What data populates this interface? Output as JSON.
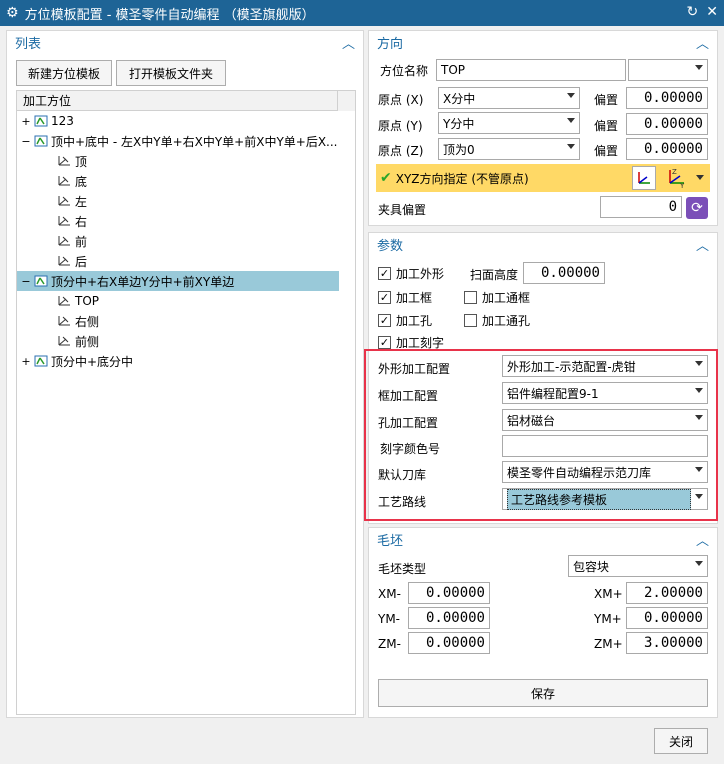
{
  "window": {
    "title": "方位模板配置 - 模圣零件自动编程 （模圣旗舰版）"
  },
  "list": {
    "header": "列表",
    "new_button": "新建方位模板",
    "open_folder_button": "打开模板文件夹",
    "tree_header": "加工方位",
    "items": [
      {
        "label": "123",
        "level": 0,
        "exp": "+"
      },
      {
        "label": "顶中+底中 - 左X中Y单+右X中Y单+前X中Y单+后X...",
        "level": 0,
        "exp": "−"
      },
      {
        "label": "顶",
        "level": 1
      },
      {
        "label": "底",
        "level": 1
      },
      {
        "label": "左",
        "level": 1
      },
      {
        "label": "右",
        "level": 1
      },
      {
        "label": "前",
        "level": 1
      },
      {
        "label": "后",
        "level": 1
      },
      {
        "label": "顶分中+右X单边Y分中+前XY单边",
        "level": 0,
        "exp": "−",
        "selected": true
      },
      {
        "label": "TOP",
        "level": 1
      },
      {
        "label": "右侧",
        "level": 1
      },
      {
        "label": "前侧",
        "level": 1
      },
      {
        "label": "顶分中+底分中",
        "level": 0,
        "exp": "+"
      }
    ]
  },
  "direction": {
    "header": "方向",
    "name_label": "方位名称",
    "name_value": "TOP",
    "origin_x_label": "原点 (X)",
    "origin_x_value": "X分中",
    "origin_y_label": "原点 (Y)",
    "origin_y_value": "Y分中",
    "origin_z_label": "原点 (Z)",
    "origin_z_value": "顶为0",
    "offset_label": "偏置",
    "offset_x": "0.00000",
    "offset_y": "0.00000",
    "offset_z": "0.00000",
    "xyz_label": "XYZ方向指定 (不管原点)",
    "fixture_label": "夹具偏置",
    "fixture_value": "0"
  },
  "params": {
    "header": "参数",
    "cb_outline": "加工外形",
    "scan_height_label": "扫面高度",
    "scan_height_value": "0.00000",
    "cb_frame": "加工框",
    "cb_through_frame": "加工通框",
    "cb_hole": "加工孔",
    "cb_through_hole": "加工通孔",
    "cb_engrave": "加工刻字",
    "outline_cfg_label": "外形加工配置",
    "outline_cfg_value": "外形加工-示范配置-虎钳",
    "frame_cfg_label": "框加工配置",
    "frame_cfg_value": "铝件编程配置9-1",
    "hole_cfg_label": "孔加工配置",
    "hole_cfg_value": "铝材磁台",
    "engrave_color_label": "刻字颜色号",
    "engrave_color_value": "",
    "tool_lib_label": "默认刀库",
    "tool_lib_value": "模圣零件自动编程示范刀库",
    "route_label": "工艺路线",
    "route_value": "工艺路线参考模板"
  },
  "blank": {
    "header": "毛坯",
    "type_label": "毛坯类型",
    "type_value": "包容块",
    "xm_minus_label": "XM-",
    "xm_minus": "0.00000",
    "xm_plus_label": "XM+",
    "xm_plus": "2.00000",
    "ym_minus_label": "YM-",
    "ym_minus": "0.00000",
    "ym_plus_label": "YM+",
    "ym_plus": "0.00000",
    "zm_minus_label": "ZM-",
    "zm_minus": "0.00000",
    "zm_plus_label": "ZM+",
    "zm_plus": "3.00000"
  },
  "save_button": "保存",
  "close_button": "关闭"
}
